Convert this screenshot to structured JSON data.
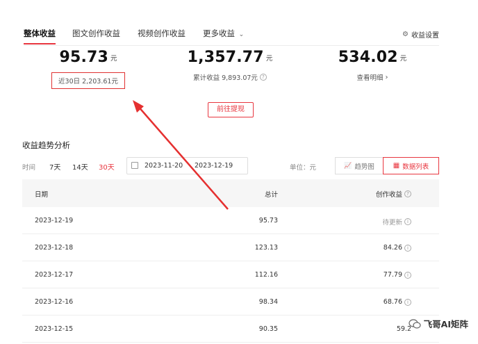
{
  "tabs": [
    {
      "label": "整体收益",
      "active": true
    },
    {
      "label": "图文创作收益",
      "active": false
    },
    {
      "label": "视频创作收益",
      "active": false
    },
    {
      "label": "更多收益",
      "active": false
    }
  ],
  "settings_label": "收益设置",
  "stats": [
    {
      "value": "95.73",
      "unit": "元",
      "sub": "近30日 2,203.61元"
    },
    {
      "value": "1,357.77",
      "unit": "元",
      "sub": "累计收益 9,893.07元"
    },
    {
      "value": "534.02",
      "unit": "元",
      "sub": "查看明细"
    }
  ],
  "withdraw_label": "前往提现",
  "trend": {
    "title": "收益趋势分析",
    "time_label": "时间",
    "periods": [
      "7天",
      "14天",
      "30天"
    ],
    "active_period": "30天",
    "start_date": "2023-11-20",
    "end_date": "2023-12-19",
    "unit_label": "单位：元",
    "views": [
      {
        "label": "趋势图",
        "active": false
      },
      {
        "label": "数据列表",
        "active": true
      }
    ]
  },
  "table": {
    "headers": [
      "日期",
      "总计",
      "创作收益"
    ],
    "rows": [
      {
        "date": "2023-12-19",
        "total": "95.73",
        "income": "待更新"
      },
      {
        "date": "2023-12-18",
        "total": "123.13",
        "income": "84.26"
      },
      {
        "date": "2023-12-17",
        "total": "112.16",
        "income": "77.79"
      },
      {
        "date": "2023-12-16",
        "total": "98.34",
        "income": "68.76"
      },
      {
        "date": "2023-12-15",
        "total": "90.35",
        "income": "59.2"
      }
    ]
  },
  "watermark": "飞哥AI矩阵",
  "colors": {
    "accent": "#e8363f",
    "highlight_box": "#e03030"
  }
}
